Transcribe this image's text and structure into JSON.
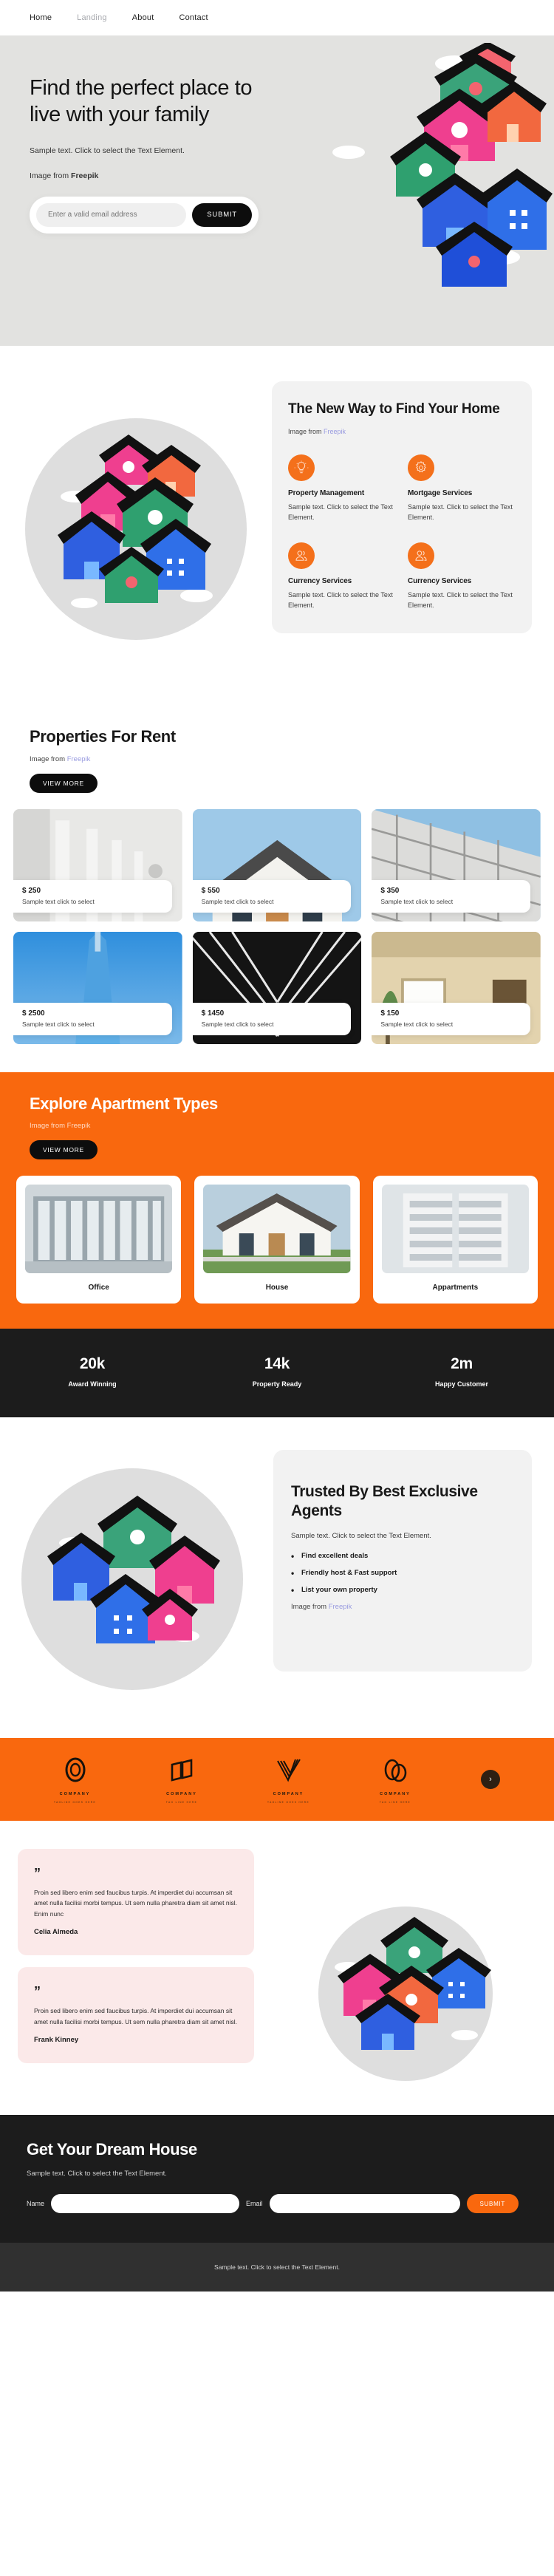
{
  "nav": {
    "items": [
      {
        "label": "Home",
        "active": false
      },
      {
        "label": "Landing",
        "active": true
      },
      {
        "label": "About",
        "active": false
      },
      {
        "label": "Contact",
        "active": false
      }
    ]
  },
  "hero": {
    "heading": "Find the perfect place to live with your family",
    "subtext": "Sample text. Click to select the Text Element.",
    "credit_prefix": "Image from ",
    "credit_source": "Freepik",
    "email_placeholder": "Enter a valid email address",
    "email_value": "",
    "submit_label": "SUBMIT",
    "bg_color": "#e2e2e0"
  },
  "newway": {
    "heading": "The New Way to Find Your Home",
    "credit_prefix": "Image from ",
    "credit_source": "Freepik",
    "features": [
      {
        "icon": "lightbulb-icon",
        "title": "Property Management",
        "text": "Sample text. Click to select the Text Element."
      },
      {
        "icon": "gear-icon",
        "title": "Mortgage Services",
        "text": "Sample text. Click to select the Text Element."
      },
      {
        "icon": "people-icon",
        "title": "Currency Services",
        "text": "Sample text. Click to select the Text Element."
      },
      {
        "icon": "people-icon",
        "title": "Currency Services",
        "text": "Sample text. Click to select the Text Element."
      }
    ]
  },
  "properties": {
    "heading": "Properties For Rent",
    "credit_prefix": "Image from ",
    "credit_source": "Freepik",
    "view_more_label": "VIEW MORE",
    "cards": [
      {
        "price": "$ 250",
        "desc": "Sample text click to select",
        "image": "white-corridor-arches"
      },
      {
        "price": "$ 550",
        "desc": "Sample text click to select",
        "image": "modern-suburban-house"
      },
      {
        "price": "$ 350",
        "desc": "Sample text click to select",
        "image": "glass-skyscraper-facade"
      },
      {
        "price": "$ 2500",
        "desc": "Sample text click to select",
        "image": "blue-sky-tower"
      },
      {
        "price": "$ 1450",
        "desc": "Sample text click to select",
        "image": "dark-atrium-interior"
      },
      {
        "price": "$ 150",
        "desc": "Sample text click to select",
        "image": "beige-house-window"
      }
    ]
  },
  "explore": {
    "heading": "Explore Apartment Types",
    "credit": "Image from Freepik",
    "view_more_label": "VIEW MORE",
    "accent_color": "#f9680e",
    "types": [
      {
        "label": "Office",
        "image": "glass-office-building"
      },
      {
        "label": "House",
        "image": "white-family-house"
      },
      {
        "label": "Appartments",
        "image": "apartment-block"
      }
    ]
  },
  "stats": {
    "bg_color": "#1c1c1c",
    "items": [
      {
        "number": "20k",
        "label": "Award Winning"
      },
      {
        "number": "14k",
        "label": "Property Ready"
      },
      {
        "number": "2m",
        "label": "Happy Customer"
      }
    ]
  },
  "trusted": {
    "heading": "Trusted By Best Exclusive Agents",
    "subtext": "Sample text. Click to select the Text Element.",
    "bullets": [
      "Find excellent deals",
      "Friendly host & Fast support",
      "List your own property"
    ],
    "credit_prefix": "Image from ",
    "credit_source": "Freepik"
  },
  "logos": {
    "bg_color": "#f9680e",
    "items": [
      {
        "mark": "oval-ring-logo",
        "name": "COMPANY",
        "tagline": "TAGLINE GOES HERE"
      },
      {
        "mark": "open-book-logo",
        "name": "COMPANY",
        "tagline": "TAG LINE HERE"
      },
      {
        "mark": "striped-v-logo",
        "name": "COMPANY",
        "tagline": "TAGLINE GOES HERE"
      },
      {
        "mark": "double-loop-logo",
        "name": "COMPANY",
        "tagline": "TAG LINE HERE"
      }
    ],
    "next_icon": "chevron-right-icon"
  },
  "testimonials": {
    "items": [
      {
        "quote_mark": "”",
        "text": "Proin sed libero enim sed faucibus turpis. At imperdiet dui accumsan sit amet nulla facilisi morbi tempus. Ut sem nulla pharetra diam sit amet nisl. Enim nunc",
        "author": "Celia Almeda"
      },
      {
        "quote_mark": "”",
        "text": "Proin sed libero enim sed faucibus turpis. At imperdiet dui accumsan sit amet nulla facilisi morbi tempus. Ut sem nulla pharetra diam sit amet nisl.",
        "author": "Frank Kinney"
      }
    ]
  },
  "cta": {
    "heading": "Get Your Dream House",
    "subtext": "Sample text. Click to select the Text Element.",
    "name_label": "Name",
    "name_value": "",
    "email_label": "Email",
    "email_value": "",
    "submit_label": "SUBMIT",
    "accent_color": "#f9680e"
  },
  "footer": {
    "text": "Sample text. Click to select the Text Element."
  }
}
